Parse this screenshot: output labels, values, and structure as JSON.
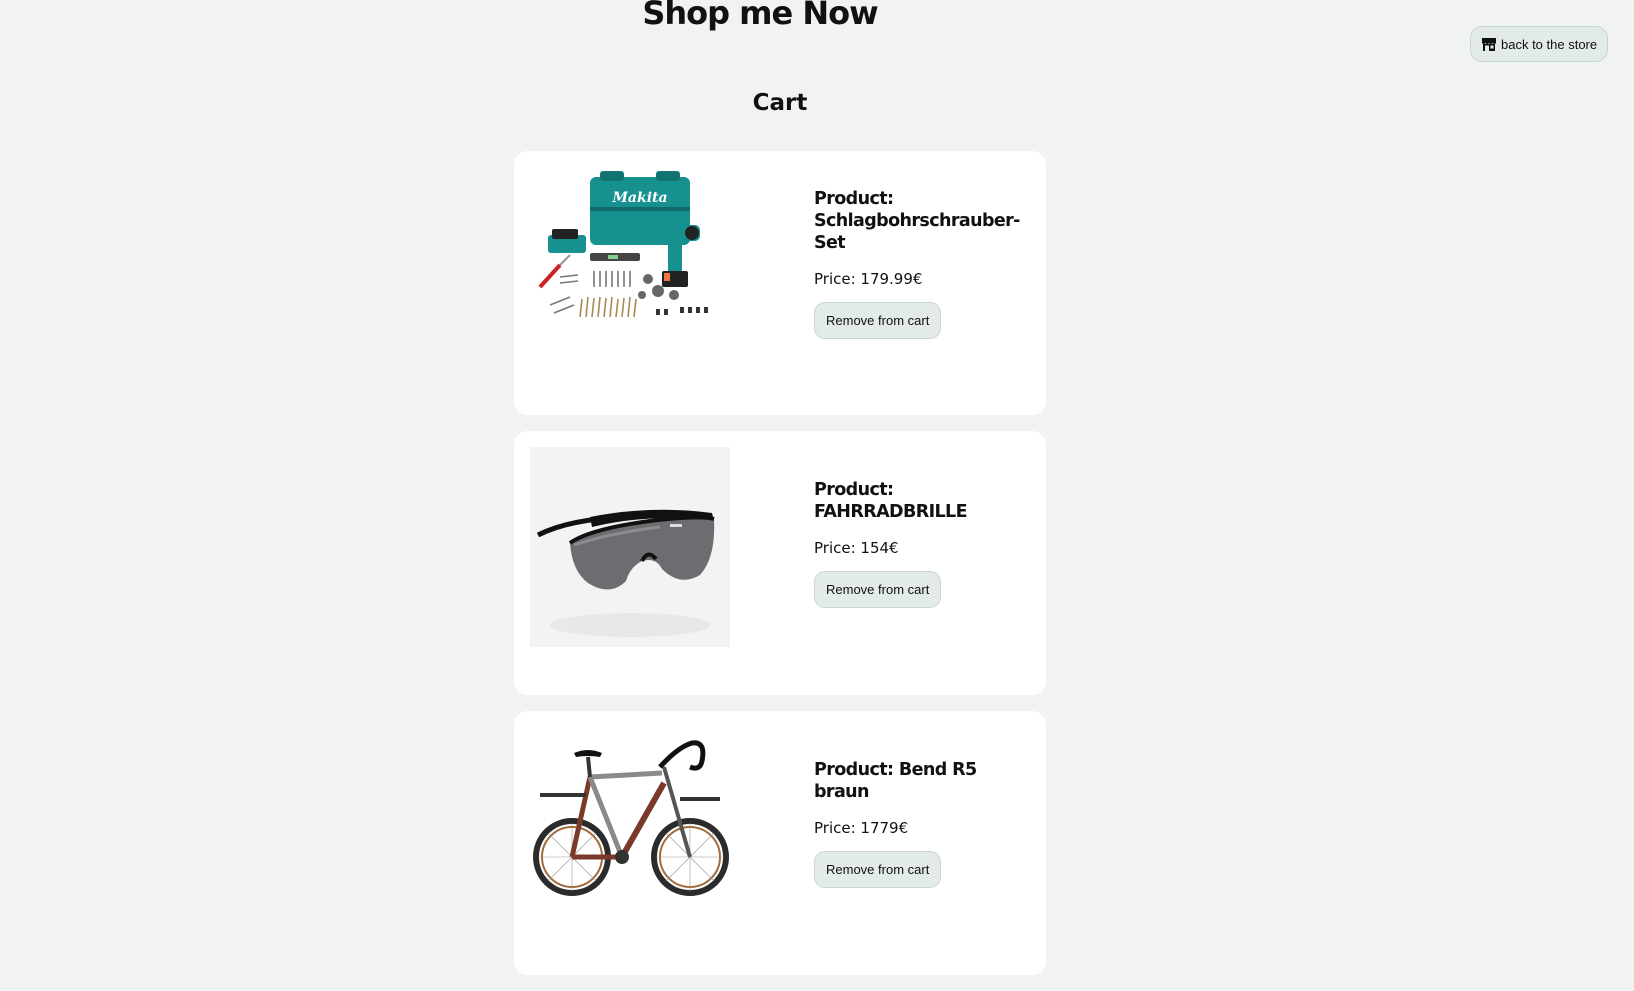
{
  "header": {
    "site_title": "Shop me Now",
    "back_button_label": "back to the store",
    "back_button_icon": "store-icon"
  },
  "cart": {
    "heading": "Cart",
    "items": [
      {
        "product_label": "Product: Schlagbohrschrauber-Set",
        "price_label": "Price: 179.99€",
        "remove_label": "Remove from cart",
        "image": "drill-set-image"
      },
      {
        "product_label": "Product: FAHRRADBRILLE",
        "price_label": "Price: 154€",
        "remove_label": "Remove from cart",
        "image": "sunglasses-image"
      },
      {
        "product_label": "Product: Bend R5 braun",
        "price_label": "Price: 1779€",
        "remove_label": "Remove from cart",
        "image": "bicycle-image"
      }
    ]
  },
  "colors": {
    "page_background": "#f1f2f4",
    "card_background": "#ffffff",
    "button_background": "#e2ebea",
    "drill_teal": "#16918f"
  }
}
